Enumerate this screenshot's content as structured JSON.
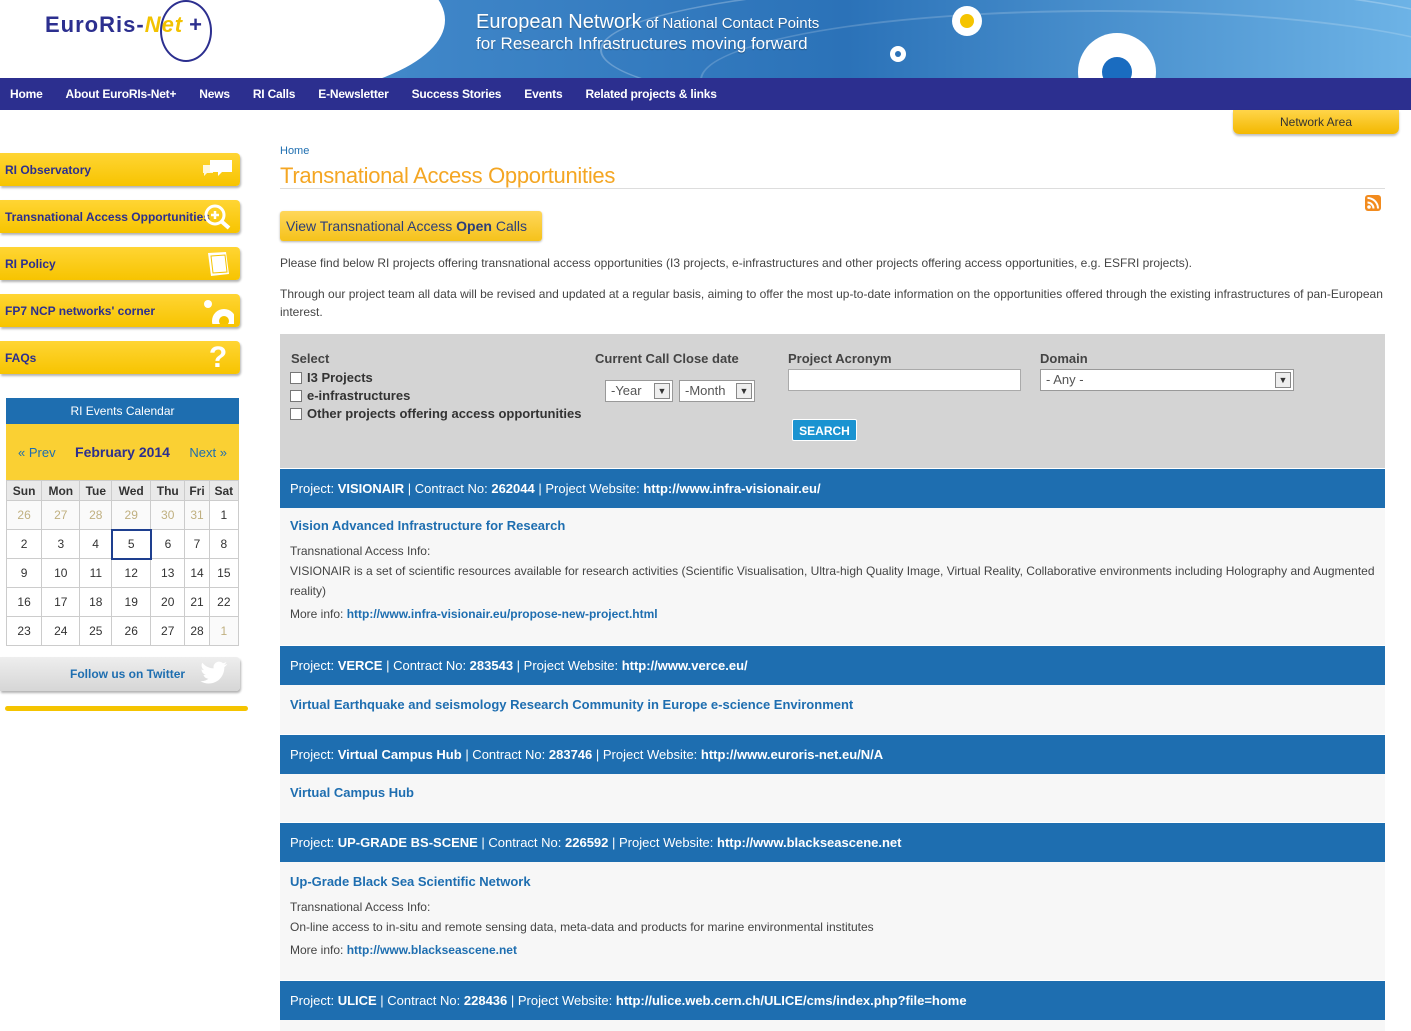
{
  "header": {
    "logo_main": "EuroRis-",
    "logo_net": "Net",
    "logo_plus": "+",
    "tagline_1a": "European Network",
    "tagline_1b": " of National Contact Points",
    "tagline_2": "for Research Infrastructures moving forward"
  },
  "nav": {
    "items": [
      "Home",
      "About EuroRIs-Net+",
      "News",
      "RI Calls",
      "E-Newsletter",
      "Success Stories",
      "Events",
      "Related projects & links"
    ]
  },
  "network_area": "Network Area",
  "sidebar": {
    "items": [
      "RI Observatory",
      "Transnational Access Opportunities",
      "RI Policy",
      "FP7 NCP networks' corner",
      "FAQs"
    ],
    "calendar": {
      "title": "RI Events Calendar",
      "prev": "« Prev",
      "month": "February 2014",
      "next": "Next »",
      "days": [
        "Sun",
        "Mon",
        "Tue",
        "Wed",
        "Thu",
        "Fri",
        "Sat"
      ],
      "weeks": [
        [
          "26",
          "27",
          "28",
          "29",
          "30",
          "31",
          "1"
        ],
        [
          "2",
          "3",
          "4",
          "5",
          "6",
          "7",
          "8"
        ],
        [
          "9",
          "10",
          "11",
          "12",
          "13",
          "14",
          "15"
        ],
        [
          "16",
          "17",
          "18",
          "19",
          "20",
          "21",
          "22"
        ],
        [
          "23",
          "24",
          "25",
          "26",
          "27",
          "28",
          "1"
        ]
      ],
      "today": "5"
    },
    "twitter": "Follow us on Twitter"
  },
  "main": {
    "breadcrumb": "Home",
    "title": "Transnational Access Opportunities",
    "open_calls_pre": "View Transnational Access ",
    "open_calls_bold": "Open",
    "open_calls_post": " Calls",
    "intro1": "Please find below RI projects offering transnational access opportunities (I3 projects, e-infrastructures and other projects offering access opportunities, e.g. ESFRI projects).",
    "intro2": "Through our project team all data will be revised and updated at a regular basis, aiming to offer the most up-to-date information on the opportunities offered through the existing infrastructures of pan-European interest."
  },
  "filter": {
    "select_label": "Select",
    "checkboxes": [
      "I3 Projects",
      "e-infrastructures",
      "Other projects offering access opportunities"
    ],
    "date_label": "Current Call Close date",
    "year": "-Year",
    "month": "-Month",
    "acronym_label": "Project Acronym",
    "acronym_value": "",
    "domain_label": "Domain",
    "domain_value": "- Any -",
    "search": "SEARCH"
  },
  "labels": {
    "project": "Project: ",
    "contract": " | Contract No: ",
    "website": " | Project Website: ",
    "ta_info": "Transnational Access Info:",
    "more_info": "More info: "
  },
  "projects": [
    {
      "acronym": "VISIONAIR",
      "contract": "262044",
      "website": "http://www.infra-visionair.eu/",
      "title": "Vision Advanced Infrastructure for Research",
      "info": "VISIONAIR is a set of scientific resources available for research activities (Scientific Visualisation, Ultra-high Quality Image, Virtual Reality, Collaborative environments including Holography and Augmented reality)",
      "more": "http://www.infra-visionair.eu/propose-new-project.html"
    },
    {
      "acronym": "VERCE",
      "contract": "283543",
      "website": "http://www.verce.eu/",
      "title": "Virtual Earthquake and seismology Research Community in Europe e-science Environment"
    },
    {
      "acronym": "Virtual Campus Hub",
      "contract": "283746",
      "website": "http://www.euroris-net.eu/N/A",
      "title": "Virtual Campus Hub"
    },
    {
      "acronym": "UP-GRADE BS-SCENE",
      "contract": "226592",
      "website": "http://www.blackseascene.net",
      "title": "Up-Grade Black Sea Scientific Network",
      "info": "On-line access to in-situ and remote sensing data, meta-data and products for marine environmental institutes",
      "more": "http://www.blackseascene.net"
    },
    {
      "acronym": "ULICE",
      "contract": "228436",
      "website": "http://ulice.web.cern.ch/ULICE/cms/index.php?file=home"
    }
  ]
}
